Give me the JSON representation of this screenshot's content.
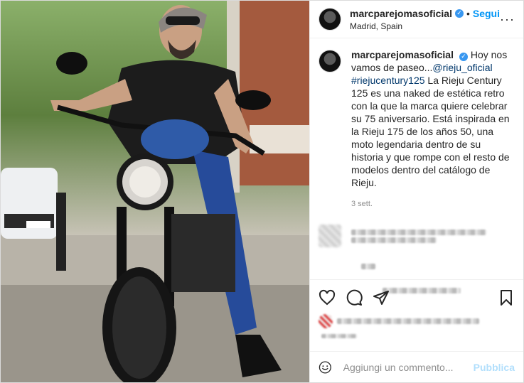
{
  "header": {
    "username": "marcparejomasoficial",
    "follow_label": "Segui",
    "separator": "•",
    "location": "Madrid, Spain",
    "more_label": "···"
  },
  "caption": {
    "username": "marcparejomasoficial",
    "text_start": "Hoy nos vamos de paseo...",
    "mention": "@rieju_oficial",
    "hashtag": "#riejucentury125",
    "text_end": "La Rieju Century 125 es una naked de estética retro con la que la marca quiere celebrar su 75 aniversario. Está inspirada en la Rieju 175 de los años 50, una moto legendaria dentro de su historia y que rompe con el resto de modelos dentro del catálogo de Rieju.",
    "time": "3 sett."
  },
  "icons": {
    "like": "heart-icon",
    "comment": "comment-icon",
    "share": "paper-plane-icon",
    "save": "bookmark-icon",
    "emoji": "smiley-icon",
    "verified": "verified-badge-icon"
  },
  "add_comment": {
    "placeholder": "Aggiungi un commento...",
    "publish_label": "Pubblica"
  },
  "colors": {
    "accent": "#0095f6",
    "link": "#00376b",
    "publish_disabled": "#b2dffc",
    "verified": "#3897f0"
  }
}
